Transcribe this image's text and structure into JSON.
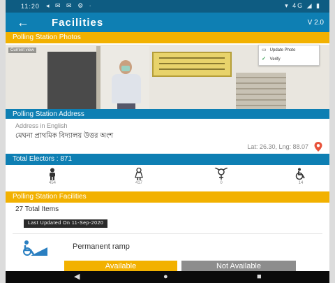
{
  "status_bar": {
    "time": "11:20",
    "notification_icons": "◂ ✉ ✉ ⚙ ·",
    "right": "▾ 4G ◢ ▮"
  },
  "app_bar": {
    "back_icon": "←",
    "title": "Facilities",
    "version": "V 2.0"
  },
  "photo_section": {
    "header": "Polling Station Photos",
    "tag": "Current view",
    "menu": [
      {
        "icon": "photo-icon",
        "label": "Update Photo"
      },
      {
        "icon": "check-icon",
        "label": "Verify"
      }
    ]
  },
  "address_section": {
    "header": "Polling Station Address",
    "label": "Address in English",
    "value": "মেঘনা প্রাথমিক বিদ্যালয় উত্তর অংশ",
    "coords": "Lat: 26.30, Lng: 88.07"
  },
  "electors_section": {
    "header": "Total Electors : 871",
    "items": [
      {
        "icon": "male-icon",
        "count": "454"
      },
      {
        "icon": "female-icon",
        "count": "417"
      },
      {
        "icon": "third-gender-icon",
        "count": "0"
      },
      {
        "icon": "pwd-wheelchair-icon",
        "count": "14"
      }
    ]
  },
  "facilities_section": {
    "header": "Polling Station Facilities",
    "subheader": "27 Total Items",
    "updated": "Last Updated On 11-Sep-2020",
    "facility": {
      "icon": "ramp-icon",
      "label": "Permanent ramp",
      "available_label": "Available",
      "not_available_label": "Not Available"
    }
  },
  "nav_bar": {
    "back": "◀",
    "home": "●",
    "recent": "■"
  },
  "colors": {
    "primary": "#0e7fb3",
    "dark": "#0e5c82",
    "accent": "#f2b100",
    "grey": "#8d8d8d"
  }
}
